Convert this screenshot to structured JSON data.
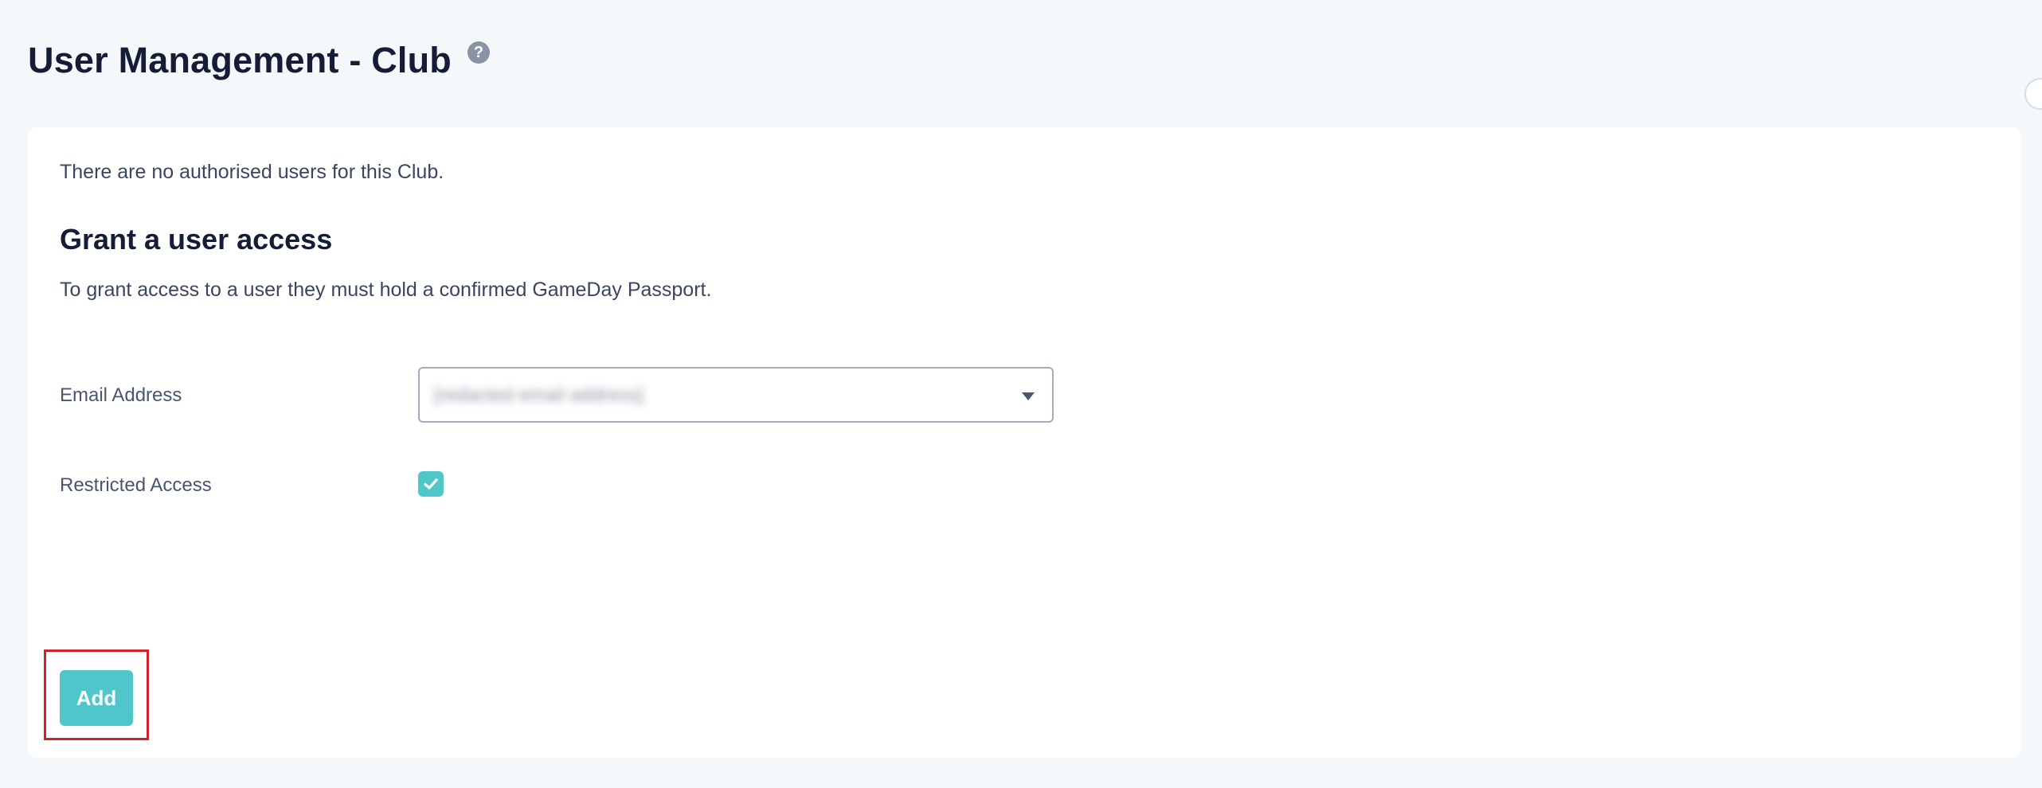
{
  "header": {
    "title": "User Management - Club",
    "help_glyph": "?"
  },
  "card": {
    "no_users_message": "There are no authorised users for this Club.",
    "section_heading": "Grant a user access",
    "instructions": "To grant access to a user they must hold a confirmed GameDay Passport."
  },
  "form": {
    "email_label": "Email Address",
    "email_value": "[redacted email address]",
    "restricted_label": "Restricted Access",
    "restricted_checked": true
  },
  "actions": {
    "add_label": "Add"
  },
  "colors": {
    "accent": "#4fc6c9",
    "highlight": "#d0242b",
    "title": "#141c36",
    "background": "#f5f8fb"
  },
  "icons": [
    "help-icon",
    "chevron-down-icon",
    "checkmark-icon"
  ]
}
